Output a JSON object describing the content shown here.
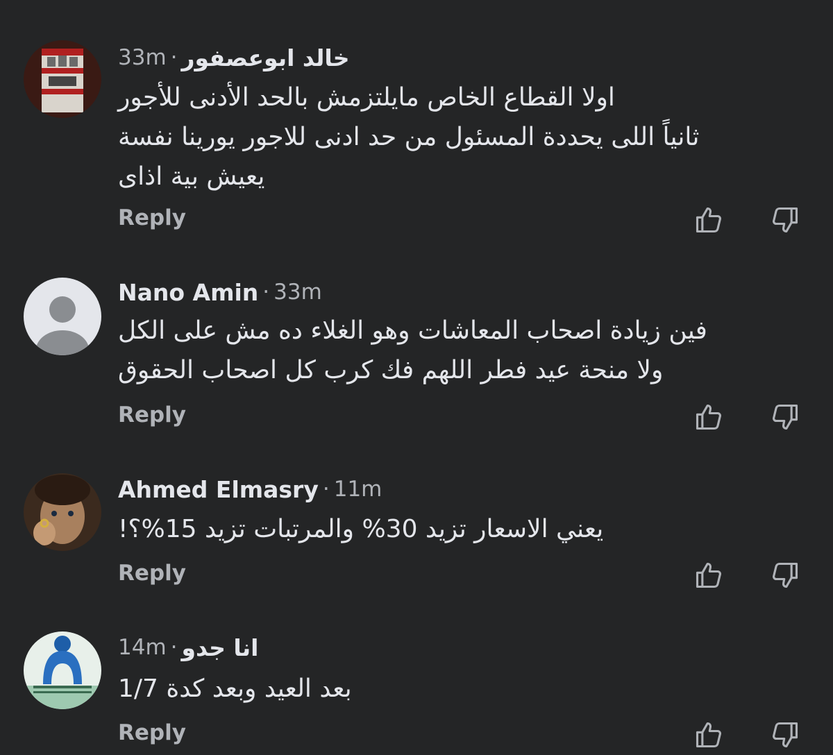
{
  "comments": [
    {
      "name": "خالد  ابوعصفور",
      "time": "33m",
      "lines": [
        "اولا القطاع الخاص مايلتزمش بالحد الأدنى للأجور",
        "ثانياً اللى يحددة المسئول من حد ادنى للاجور يورينا نفسة",
        "يعيش بية اذاى"
      ],
      "reply": "Reply",
      "avatar": "fist-badge-avatar"
    },
    {
      "name": "Nano Amin",
      "time": "33m",
      "lines": [
        "فين زيادة اصحاب المعاشات وهو الغلاء ده مش على الكل",
        "ولا منحة عيد فطر اللهم فك كرب كل اصحاب الحقوق"
      ],
      "reply": "Reply",
      "avatar": "default-person-avatar"
    },
    {
      "name": "Ahmed Elmasry",
      "time": "11m",
      "lines": [
        "يعني الاسعار تزيد 30% والمرتبات تزيد 15%؟!"
      ],
      "reply": "Reply",
      "avatar": "photo-avatar"
    },
    {
      "name": "انا جدو",
      "time": "14m",
      "lines": [
        "بعد العيد وبعد كدة 1/7"
      ],
      "reply": "Reply",
      "avatar": "blue-ornament-avatar"
    }
  ],
  "separator": "·",
  "icons": {
    "like": "thumbs-up-icon",
    "dislike": "thumbs-down-icon"
  },
  "colors": {
    "background": "#242526",
    "text": "#e4e6eb",
    "secondary": "#b0b3b8"
  }
}
